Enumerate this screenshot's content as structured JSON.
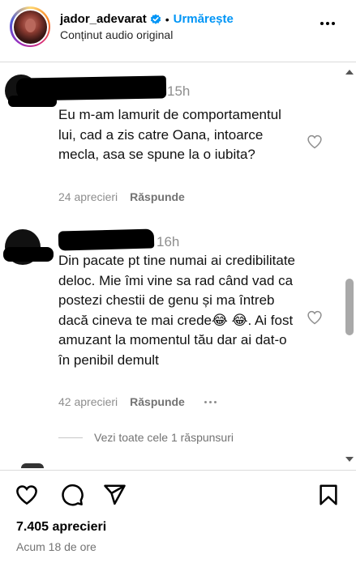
{
  "header": {
    "username": "jador_adevarat",
    "dot": "•",
    "follow_label": "Urmărește",
    "subtitle": "Conținut audio original"
  },
  "comments": [
    {
      "time": "15h",
      "text": "Eu m-am lamurit de comportamentul lui, cad a zis catre Oana, intoarce mecla, asa se spune la o iubita?",
      "likes": "24 aprecieri",
      "reply_label": "Răspunde"
    },
    {
      "time": "16h",
      "text": "Din pacate pt tine numai ai credibilitate deloc. Mie îmi vine sa rad când vad ca postezi chestii de genu și ma întreb dacă cineva te mai crede😂 😂. Ai fost amuzant la momentul tău dar ai dat-o în penibil demult",
      "likes": "42 aprecieri",
      "reply_label": "Răspunde"
    }
  ],
  "view_replies_label": "Vezi toate cele 1 răspunsuri",
  "post": {
    "likes": "7.405 aprecieri",
    "time_ago": "Acum 18 de ore"
  },
  "colors": {
    "accent": "#0095f6",
    "muted": "#8e8e8e",
    "divider": "#dbdbdb"
  }
}
